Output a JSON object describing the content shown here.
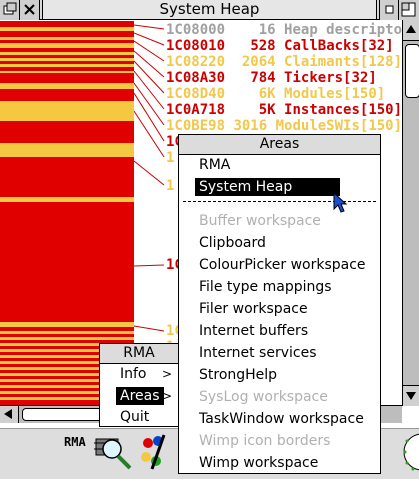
{
  "window": {
    "title": "System Heap",
    "entries": [
      {
        "addr": "1C08000",
        "size": "16",
        "name": "Heap descriptor",
        "color": "grey"
      },
      {
        "addr": "1C08010",
        "size": "528",
        "name": "CallBacks[32]",
        "color": "red"
      },
      {
        "addr": "1C08220",
        "size": "2064",
        "name": "Claimants[128]",
        "color": "yellow"
      },
      {
        "addr": "1C08A30",
        "size": "784",
        "name": "Tickers[32]",
        "color": "red"
      },
      {
        "addr": "1C08D40",
        "size": "6K",
        "name": "Modules[150]",
        "color": "yellow"
      },
      {
        "addr": "1C0A718",
        "size": "5K",
        "name": "Instances[150]",
        "color": "red"
      },
      {
        "addr": "1C0BE98",
        "size": "3016",
        "name": "ModuleSWIs[150]",
        "color": "yellow"
      }
    ],
    "fragments": [
      {
        "text": "1C",
        "color": "red"
      },
      {
        "text": "1",
        "color": "yellow"
      },
      {
        "text": "1",
        "color": "yellow"
      },
      {
        "text": "1C",
        "color": "red"
      },
      {
        "text": "1C",
        "color": "yellow"
      },
      {
        "text": "1",
        "color": "yellow"
      }
    ],
    "colors": {
      "red": "#e00000",
      "yellow": "#f5c842",
      "grey": "#a0a0a0"
    }
  },
  "rma_menu": {
    "title": "RMA",
    "items": [
      {
        "label": "Info",
        "submenu": true
      },
      {
        "label": "Areas",
        "submenu": true,
        "selected": true
      },
      {
        "label": "Quit",
        "submenu": false
      }
    ]
  },
  "areas_menu": {
    "title": "Areas",
    "items": [
      {
        "label": "RMA",
        "disabled": false
      },
      {
        "label": "System Heap",
        "disabled": false,
        "selected": true
      },
      {
        "label": "Buffer workspace",
        "disabled": true
      },
      {
        "label": "Clipboard",
        "disabled": false
      },
      {
        "label": "ColourPicker workspace",
        "disabled": false
      },
      {
        "label": "File type mappings",
        "disabled": false
      },
      {
        "label": "Filer workspace",
        "disabled": false
      },
      {
        "label": "Internet buffers",
        "disabled": false
      },
      {
        "label": "Internet services",
        "disabled": false
      },
      {
        "label": "StrongHelp",
        "disabled": false
      },
      {
        "label": "SysLog workspace",
        "disabled": true
      },
      {
        "label": "TaskWindow workspace",
        "disabled": false
      },
      {
        "label": "Wimp icon borders",
        "disabled": true
      },
      {
        "label": "Wimp workspace",
        "disabled": false
      }
    ]
  },
  "iconbar": {
    "rma_label": "RMA"
  }
}
